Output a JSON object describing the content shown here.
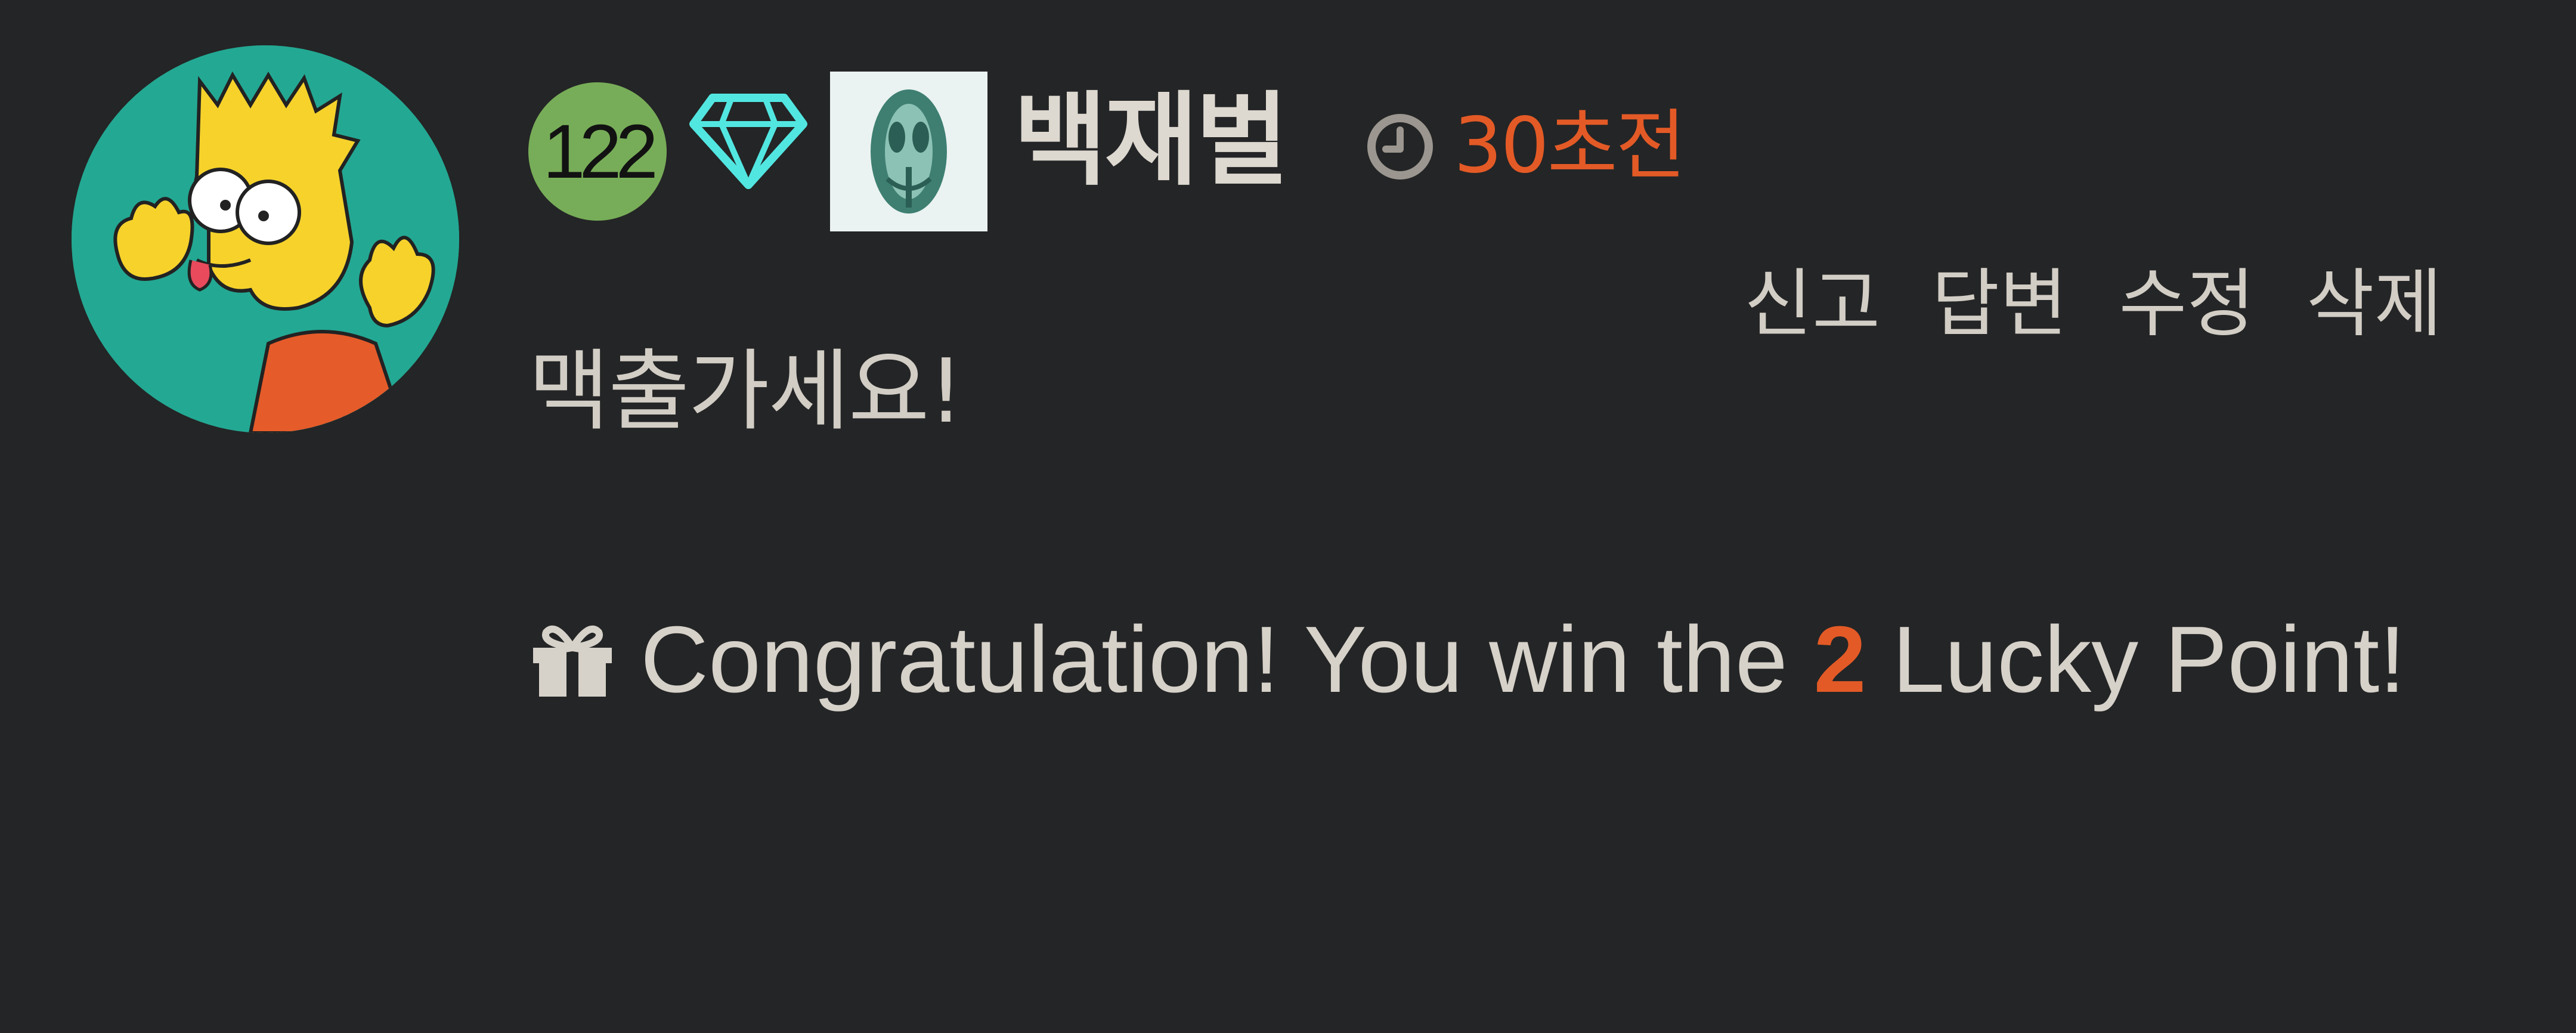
{
  "comment": {
    "level": "122",
    "username": "백재벌",
    "timestamp": "30초전",
    "text": "맥출가세요!",
    "actions": [
      "신고",
      "답변",
      "수정",
      "삭제"
    ]
  },
  "lucky": {
    "prefix": "Congratulation! You win the ",
    "points": "2",
    "suffix": " Lucky Point!"
  },
  "colors": {
    "background": "#242526",
    "accent": "#e35a26",
    "level_badge": "#77ad58",
    "diamond": "#52e6e1",
    "avatar_bg": "#23a893"
  },
  "icons": {
    "avatar": "cartoon-avatar",
    "diamond": "diamond-icon",
    "member": "member-image-icon",
    "clock": "clock-icon",
    "gift": "gift-icon"
  }
}
